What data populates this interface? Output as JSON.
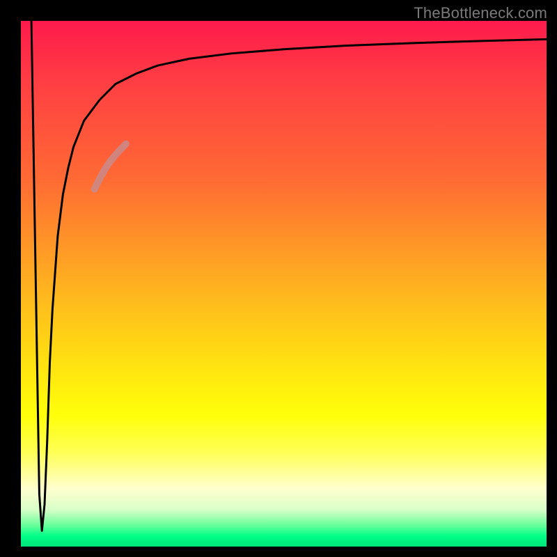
{
  "attribution": "TheBottleneck.com",
  "chart_data": {
    "type": "line",
    "title": "",
    "xlabel": "",
    "ylabel": "",
    "xlim": [
      0,
      100
    ],
    "ylim": [
      0,
      100
    ],
    "series": [
      {
        "name": "bottleneck-curve",
        "type": "line",
        "color": "#000000",
        "x": [
          2.0,
          3.0,
          3.5,
          4.0,
          4.5,
          5.0,
          5.5,
          6.0,
          7.0,
          8.0,
          9.0,
          10.0,
          12.0,
          15.0,
          18.0,
          22.0,
          26.0,
          32.0,
          40.0,
          50.0,
          62.0,
          75.0,
          88.0,
          100.0
        ],
        "y": [
          100.0,
          40.0,
          10.0,
          3.0,
          8.0,
          20.0,
          35.0,
          45.0,
          59.0,
          67.0,
          72.0,
          76.0,
          81.0,
          85.0,
          88.0,
          90.0,
          91.5,
          92.8,
          93.8,
          94.6,
          95.3,
          95.8,
          96.2,
          96.5
        ]
      },
      {
        "name": "highlight-segment",
        "type": "line",
        "color": "#c98b8b",
        "width": 10,
        "x": [
          14.0,
          15.0,
          16.0,
          17.0,
          18.0,
          19.0,
          20.0
        ],
        "y": [
          68.0,
          70.0,
          71.8,
          73.3,
          74.5,
          75.6,
          76.6
        ]
      }
    ],
    "grid": false
  }
}
